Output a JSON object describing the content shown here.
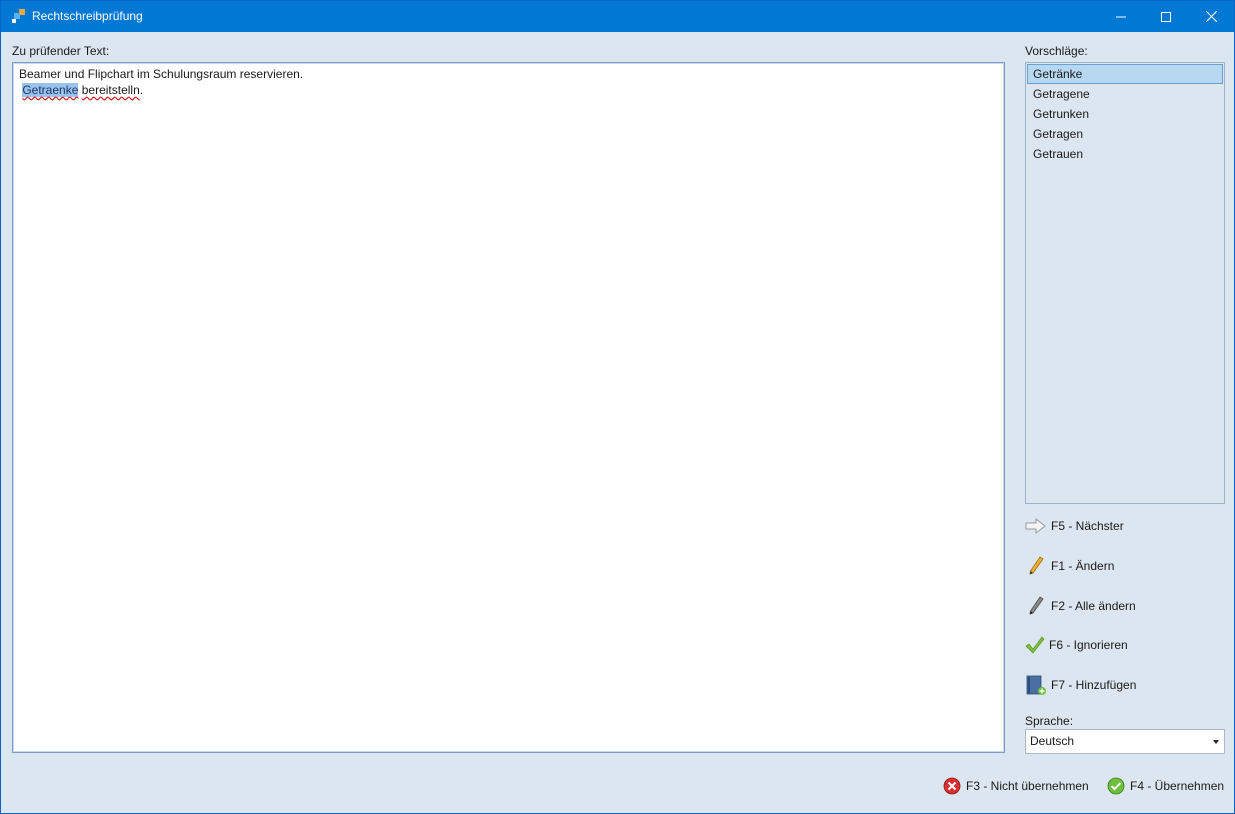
{
  "window": {
    "title": "Rechtschreibprüfung",
    "accent": "#0078d4"
  },
  "editor": {
    "label": "Zu prüfender Text:",
    "line1": "Beamer und Flipchart im Schulungsraum reservieren.",
    "line2_prefix": " ",
    "line2_selected_word": "Getraenke",
    "line2_space": " ",
    "line2_error_word": "bereitstelln",
    "line2_suffix": "."
  },
  "suggestions": {
    "label": "Vorschläge:",
    "items": [
      "Getränke",
      "Getragene",
      "Getrunken",
      "Getragen",
      "Getrauen"
    ],
    "selected_index": 0
  },
  "actions": {
    "next": "F5 - Nächster",
    "change": "F1 - Ändern",
    "change_all": "F2 - Alle ändern",
    "ignore": "F6 - Ignorieren",
    "add": "F7 - Hinzufügen"
  },
  "language": {
    "label": "Sprache:",
    "value": "Deutsch"
  },
  "footer": {
    "cancel": "F3 - Nicht übernehmen",
    "apply": "F4 - Übernehmen"
  },
  "icons": {
    "title": "app-icon",
    "next": "arrow-right-icon",
    "change": "pencil-icon",
    "change_all": "pencil-gray-icon",
    "ignore": "checkmark-icon",
    "add": "book-add-icon",
    "cancel": "red-x-icon",
    "apply": "green-check-icon"
  }
}
